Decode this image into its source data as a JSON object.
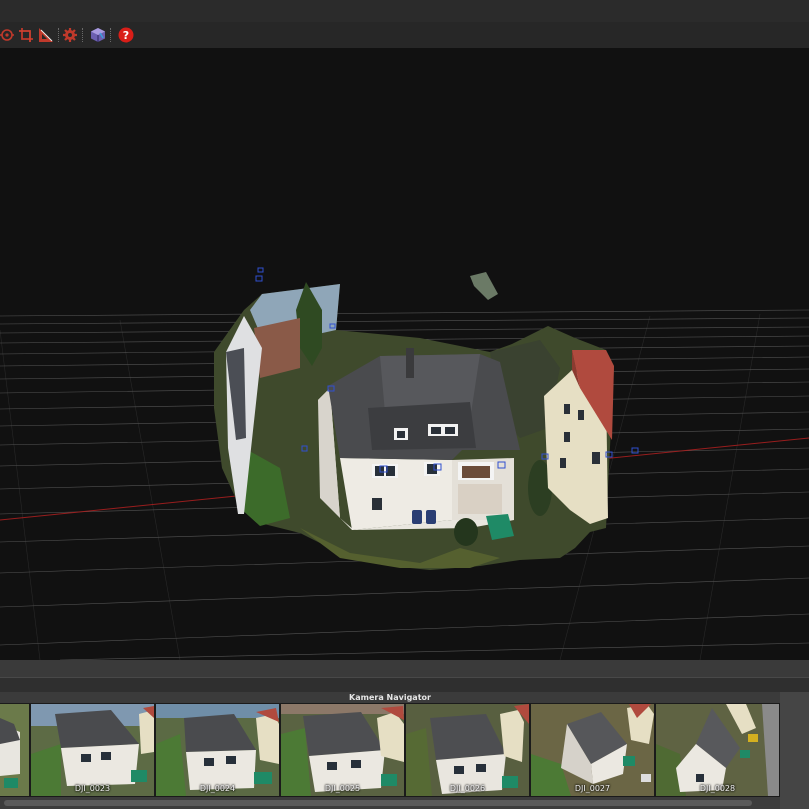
{
  "toolbar": {
    "buttons": [
      {
        "name": "rotate-view-icon",
        "color": "#c0392b"
      },
      {
        "name": "crop-icon",
        "color": "#c0392b"
      },
      {
        "name": "measure-icon",
        "color": "#c0392b"
      },
      {
        "name": "settings-gear-icon",
        "color": "#c0392b"
      },
      {
        "name": "cube-view-icon",
        "color": "#8e7cc3"
      },
      {
        "name": "help-icon",
        "color": "#d91e18",
        "glyph": "?"
      }
    ]
  },
  "viewport": {
    "description_colors": {
      "background": "#111111",
      "grid": "#6a6a6a",
      "axis": "#b02020",
      "camera_marker": "#3050d0"
    }
  },
  "navigator": {
    "title": "Kamera Navigator",
    "thumbnails": [
      {
        "label": ""
      },
      {
        "label": "DJI_0023"
      },
      {
        "label": "DJI_0024"
      },
      {
        "label": "DJI_0025"
      },
      {
        "label": "DJI_0026"
      },
      {
        "label": "DJI_0027"
      },
      {
        "label": "DJI_0028"
      }
    ]
  }
}
